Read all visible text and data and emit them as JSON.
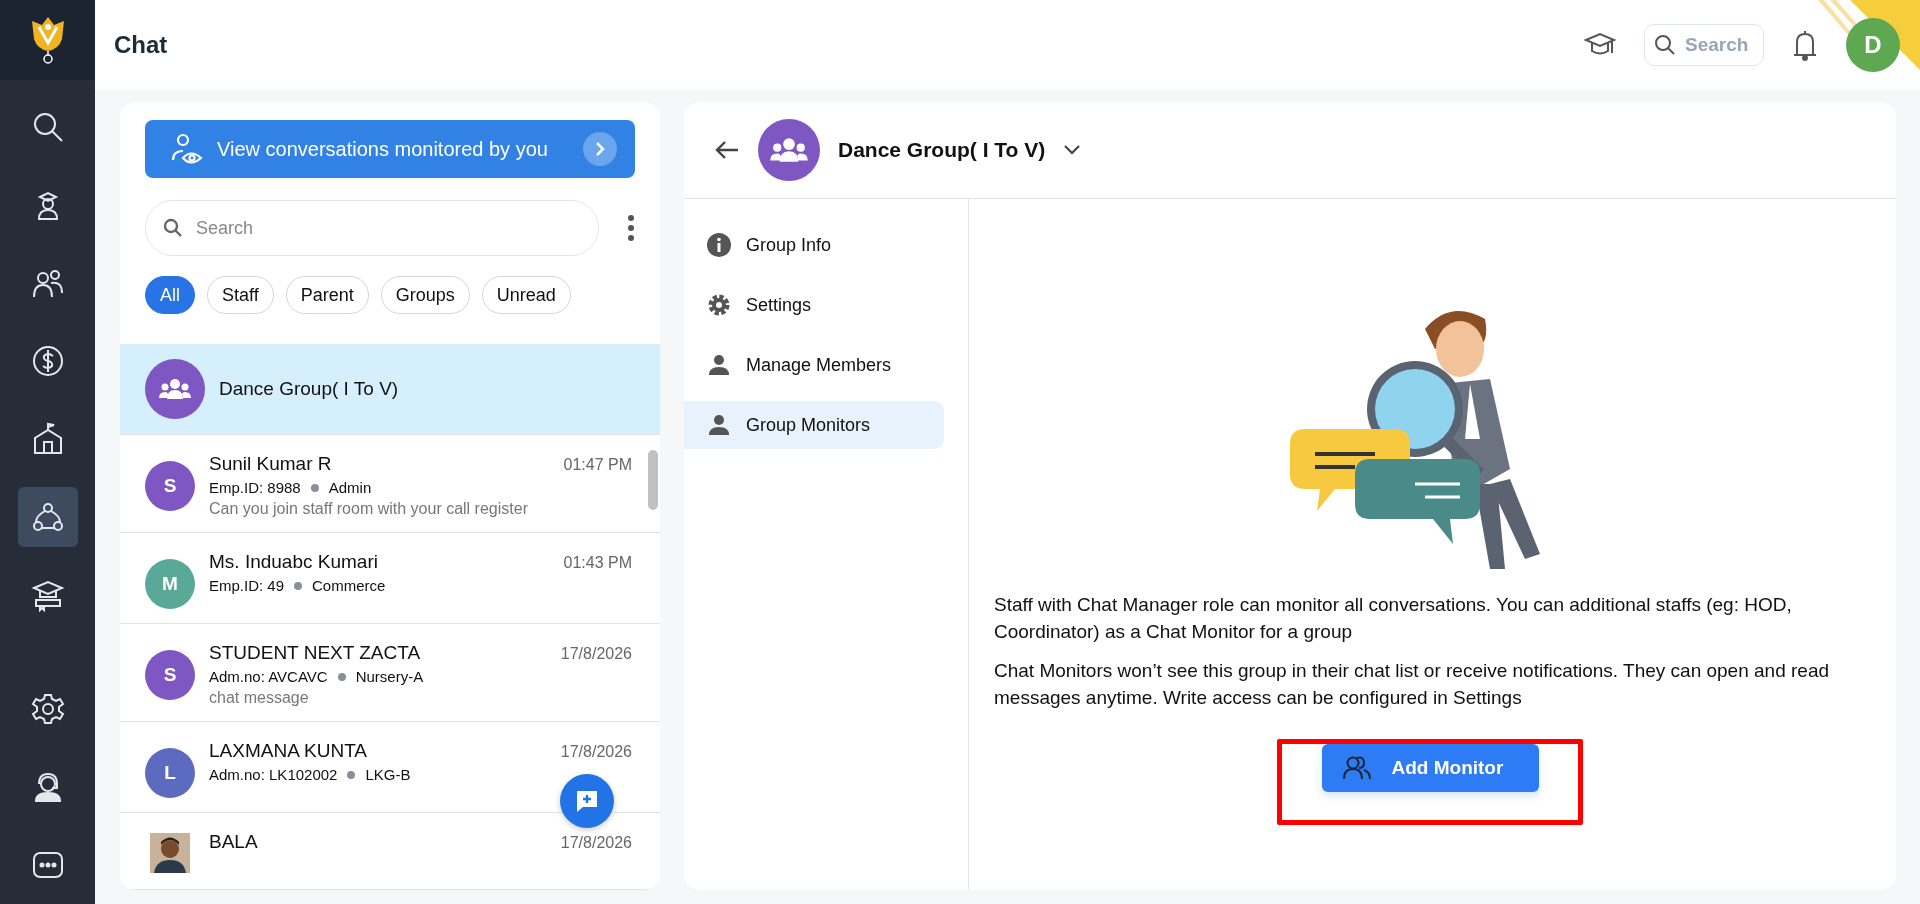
{
  "app": {
    "title": "Chat"
  },
  "nav": [
    {
      "kind": "search",
      "selected": false
    },
    {
      "kind": "student",
      "selected": false
    },
    {
      "kind": "people",
      "selected": false
    },
    {
      "kind": "dollar",
      "selected": false
    },
    {
      "kind": "building",
      "selected": false
    },
    {
      "kind": "chat",
      "selected": true
    },
    {
      "kind": "graduation",
      "selected": false
    },
    {
      "kind": "settings",
      "selected": false
    },
    {
      "kind": "support",
      "selected": false
    },
    {
      "kind": "more",
      "selected": false
    }
  ],
  "header": {
    "search": {
      "placeholder": "Search"
    },
    "avatar": "D"
  },
  "monitor_banner": "View conversations monitored by you",
  "list_search": {
    "placeholder": "Search"
  },
  "filters": [
    {
      "label": "All",
      "selected": true
    },
    {
      "label": "Staff",
      "selected": false
    },
    {
      "label": "Parent",
      "selected": false
    },
    {
      "label": "Groups",
      "selected": false
    },
    {
      "label": "Unread",
      "selected": false
    }
  ],
  "conversations": [
    {
      "kind": "group",
      "color": "#7e57c2",
      "name": "Dance Group( I To V)",
      "selected": true
    },
    {
      "kind": "initial",
      "initial": "S",
      "color": "#7e57c2",
      "name": "Sunil Kumar R",
      "time": "01:47 PM",
      "id_text": "Emp.ID: 8988",
      "tag": "Admin",
      "message": "Can you join staff room with your call register",
      "selected": false
    },
    {
      "kind": "initial",
      "initial": "M",
      "color": "#5aa897",
      "name": "Ms. Induabc Kumari",
      "time": "01:43 PM",
      "id_text": "Emp.ID: 49",
      "tag": "Commerce",
      "selected": false
    },
    {
      "kind": "initial",
      "initial": "S",
      "color": "#7e57c2",
      "name": "STUDENT NEXT ZACTA",
      "time": "17/8/2026",
      "id_text": "Adm.no: AVCAVC",
      "tag": "Nursery-A",
      "message": "chat message",
      "selected": false
    },
    {
      "kind": "initial",
      "initial": "L",
      "color": "#5c6bc0",
      "name": "LAXMANA KUNTA",
      "time": "17/8/2026",
      "id_text": "Adm.no: LK102002",
      "tag": "LKG-B",
      "selected": false
    },
    {
      "name": "BALA",
      "time": "17/8/2026",
      "selected": false
    }
  ],
  "group": {
    "name": "Dance Group( I To V)"
  },
  "group_menu": [
    {
      "kind": "info",
      "label": "Group Info",
      "selected": false
    },
    {
      "kind": "gear",
      "label": "Settings",
      "selected": false
    },
    {
      "kind": "person",
      "label": "Manage Members",
      "selected": false
    },
    {
      "kind": "person",
      "label": "Group Monitors",
      "selected": true
    }
  ],
  "description": [
    "Staff with Chat Manager role can monitor all conversations. You can additional staffs (eg: HOD, Coordinator) as a Chat Monitor for a group",
    "Chat Monitors won’t see this group in their chat list or receive notifications. They can open and read messages anytime. Write access can be configured in Settings"
  ],
  "add_button": "Add Monitor"
}
